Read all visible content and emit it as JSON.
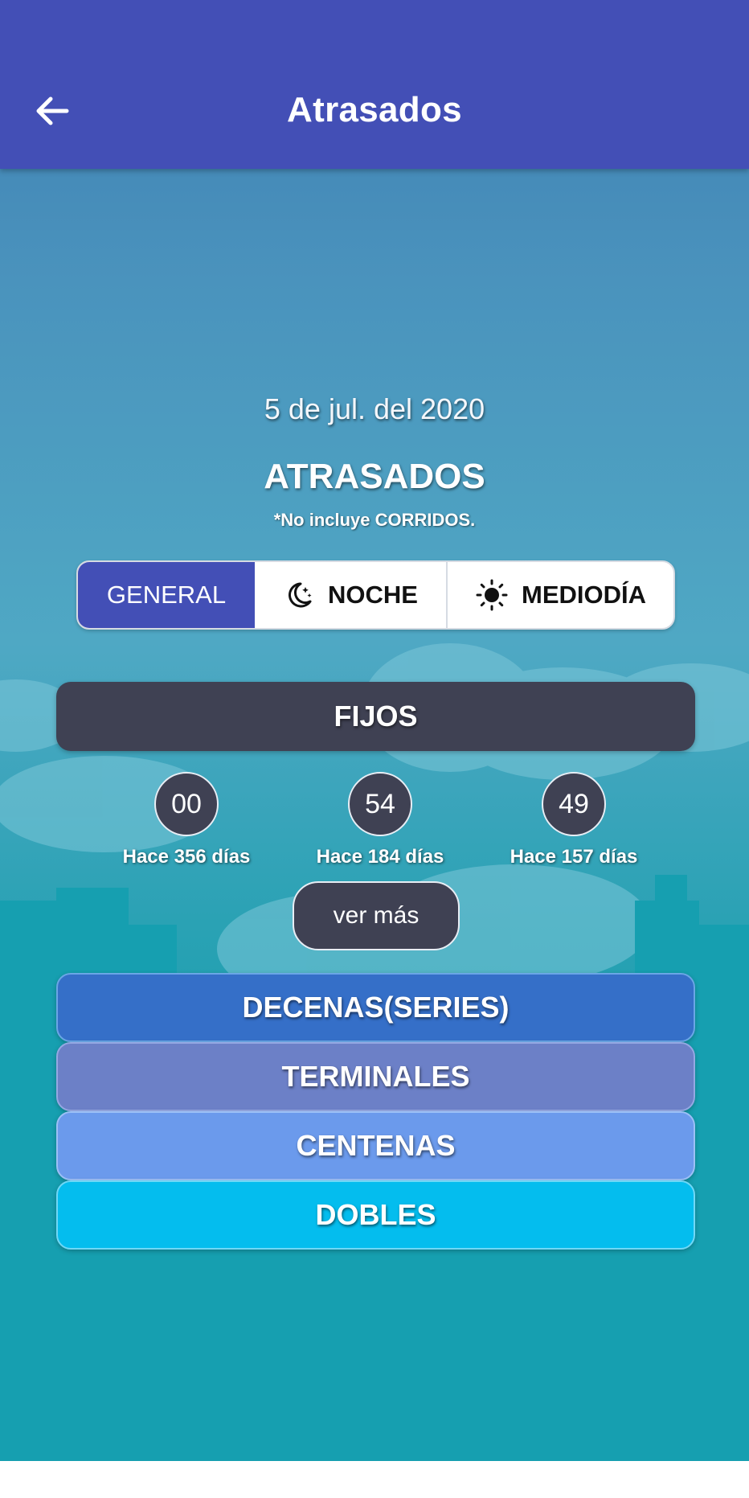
{
  "appbar": {
    "title": "Atrasados",
    "back_icon": "arrow-left-icon"
  },
  "date": "5 de jul. del 2020",
  "heading": "ATRASADOS",
  "note": "*No incluye CORRIDOS.",
  "segments": [
    {
      "label": "GENERAL",
      "active": true
    },
    {
      "label": "NOCHE",
      "icon": "moon-stars-icon",
      "active": false
    },
    {
      "label": "MEDIODÍA",
      "icon": "sun-icon",
      "active": false
    }
  ],
  "fijos": {
    "label": "FIJOS",
    "numbers": [
      {
        "value": "00",
        "ago": "Hace 356 días"
      },
      {
        "value": "54",
        "ago": "Hace 184 días"
      },
      {
        "value": "49",
        "ago": "Hace 157 días"
      }
    ],
    "more_label": "ver más"
  },
  "sections": [
    {
      "label": "DECENAS(SERIES)",
      "color": "#356fc8"
    },
    {
      "label": "TERMINALES",
      "color": "#6c80c7"
    },
    {
      "label": "CENTENAS",
      "color": "#6b9aec"
    },
    {
      "label": "DOBLES",
      "color": "#04bdee"
    }
  ],
  "colors": {
    "appbar": "#434fb6",
    "dark": "#3f4153"
  }
}
